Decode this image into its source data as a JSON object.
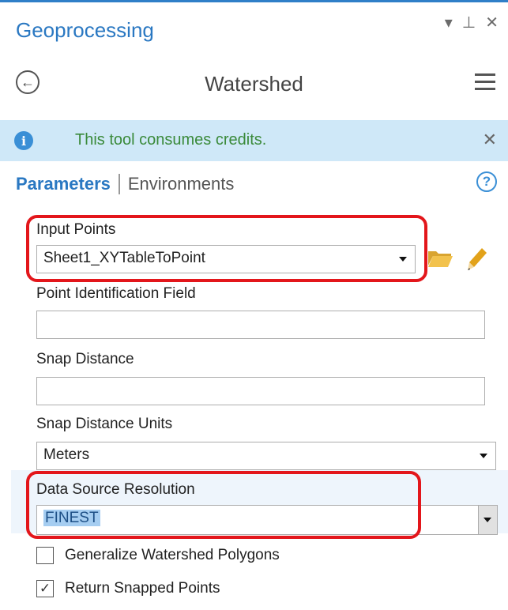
{
  "pane": {
    "title": "Geoprocessing",
    "controls": {
      "dropdown": "▾",
      "pin": "⊥",
      "close": "✕"
    }
  },
  "tool": {
    "title": "Watershed",
    "back_glyph": "←"
  },
  "info_bar": {
    "message": "This tool consumes credits.",
    "close": "✕",
    "info_glyph": "i"
  },
  "tabs": {
    "parameters": "Parameters",
    "environments": "Environments",
    "help_glyph": "?"
  },
  "params": {
    "input_points": {
      "label": "Input Points",
      "value": "Sheet1_XYTableToPoint"
    },
    "point_id_field": {
      "label": "Point Identification Field",
      "value": ""
    },
    "snap_distance": {
      "label": "Snap Distance",
      "value": ""
    },
    "snap_distance_units": {
      "label": "Snap Distance Units",
      "value": "Meters"
    },
    "data_source_resolution": {
      "label": "Data Source Resolution",
      "value": "FINEST"
    }
  },
  "checkboxes": {
    "generalize": {
      "label": "Generalize Watershed Polygons",
      "checked": false,
      "mark": ""
    },
    "return_snapped": {
      "label": "Return Snapped Points",
      "checked": true,
      "mark": "✓"
    }
  },
  "colors": {
    "accent": "#2a78c2",
    "highlight": "#e3161b",
    "info_bg": "#cfe8f8",
    "info_text": "#3a8a3a"
  }
}
